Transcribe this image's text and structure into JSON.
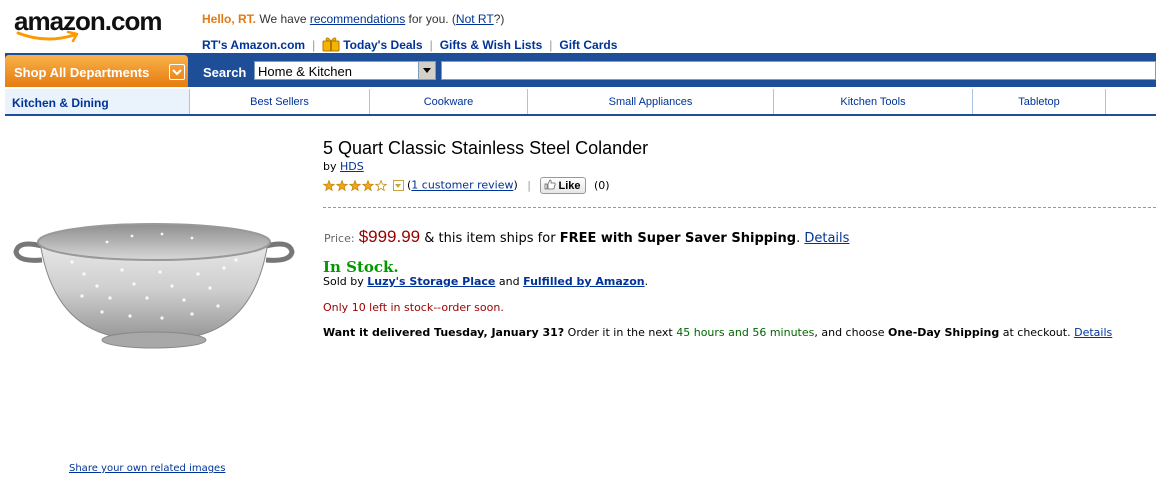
{
  "header": {
    "logo_text": "amazon.com",
    "greeting_hello": "Hello, RT.",
    "greeting_mid": " We have ",
    "recommendations_link": "recommendations",
    "greeting_for_you": " for you. (",
    "not_rt_link": "Not RT",
    "greeting_end": "?)",
    "links": [
      "RT's Amazon.com",
      "Today's Deals",
      "Gifts & Wish Lists",
      "Gift Cards"
    ]
  },
  "nav": {
    "shop_all": "Shop All Departments",
    "search_label": "Search",
    "search_category": "Home & Kitchen",
    "search_query": ""
  },
  "subnav": {
    "current": "Kitchen & Dining",
    "items": [
      "Best Sellers",
      "Cookware",
      "Small Appliances",
      "Kitchen Tools",
      "Tabletop"
    ]
  },
  "product": {
    "title": "5 Quart Classic Stainless Steel Colander",
    "by": "by ",
    "brand": "HDS",
    "rating_stars": 4,
    "rating_max": 5,
    "review_link": "1 customer review",
    "like_label": "Like",
    "like_count": "(0)",
    "price_label": "Price:",
    "price": "$999.99",
    "shipping_pre": " & this item ships for ",
    "shipping_bold": "FREE with Super Saver Shipping",
    "shipping_details": "Details",
    "stock_status": "In Stock.",
    "sold_by_pre": "Sold by ",
    "seller": "Luzy's Storage Place",
    "sold_by_and": " and ",
    "fulfilled": "Fulfilled by Amazon",
    "stock_warning": "Only 10 left in stock--order soon.",
    "delivery_bold": "Want it delivered Tuesday, January 31?",
    "delivery_mid": " Order it in the next ",
    "delivery_time": "45 hours and 56 minutes",
    "delivery_choose": ", and choose ",
    "delivery_option": "One-Day Shipping",
    "delivery_end": " at checkout. ",
    "delivery_details": "Details"
  },
  "share_images_link": "Share your own related images",
  "colors": {
    "nav_blue": "#1f4e99",
    "shop_orange": "#e57b10",
    "price_red": "#990000",
    "stock_green": "#009900",
    "link_blue": "#003399"
  }
}
